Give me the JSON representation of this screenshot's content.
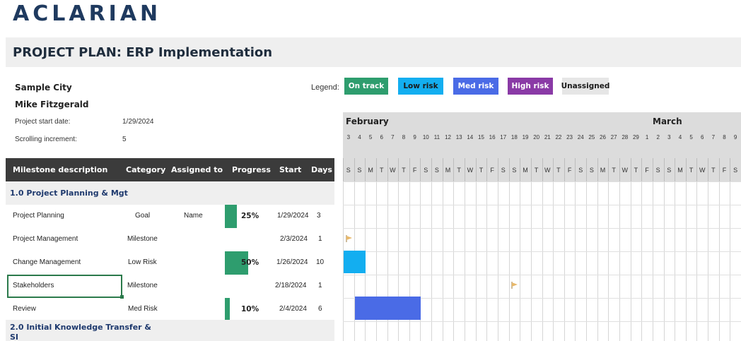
{
  "brand": {
    "logo_text": "ACLARIAN"
  },
  "title": "PROJECT PLAN:  ERP Implementation",
  "info": {
    "company": "Sample City",
    "manager": "Mike Fitzgerald",
    "start_label": "Project start date:",
    "start_value": "1/29/2024",
    "increment_label": "Scrolling increment:",
    "increment_value": "5"
  },
  "legend": {
    "label": "Legend:",
    "items": [
      {
        "label": "On track",
        "bg": "#2e9d6e",
        "fg": "#ffffff"
      },
      {
        "label": "Low risk",
        "bg": "#13aef0",
        "fg": "#1a1a1a"
      },
      {
        "label": "Med risk",
        "bg": "#4a6be6",
        "fg": "#ffffff"
      },
      {
        "label": "High risk",
        "bg": "#8a3aa6",
        "fg": "#ffffff"
      },
      {
        "label": "Unassigned",
        "bg": "#e6e6e6",
        "fg": "#1a1a1a"
      }
    ]
  },
  "table": {
    "headers": {
      "milestone": "Milestone description",
      "category": "Category",
      "assigned": "Assigned to",
      "progress": "Progress",
      "start": "Start",
      "days": "Days"
    },
    "section1": "1.0  Project Planning & Mgt",
    "rows": [
      {
        "milestone": "Project Planning",
        "category": "Goal",
        "assigned": "Name",
        "progress": 25,
        "progress_label": "25%",
        "start": "1/29/2024",
        "days": "3"
      },
      {
        "milestone": "Project Management",
        "category": "Milestone",
        "assigned": "",
        "progress": 0,
        "progress_label": "",
        "start": "2/3/2024",
        "days": "1"
      },
      {
        "milestone": "Change Management",
        "category": "Low Risk",
        "assigned": "",
        "progress": 50,
        "progress_label": "50%",
        "start": "1/26/2024",
        "days": "10"
      },
      {
        "milestone": "Stakeholders",
        "category": "Milestone",
        "assigned": "",
        "progress": 0,
        "progress_label": "",
        "start": "2/18/2024",
        "days": "1"
      },
      {
        "milestone": "Review",
        "category": "Med Risk",
        "assigned": "",
        "progress": 10,
        "progress_label": "10%",
        "start": "2/4/2024",
        "days": "6"
      }
    ],
    "section2_line1": "2.0  Initial Knowledge Transfer &",
    "section2_line2": "SI"
  },
  "gantt": {
    "month1": "February",
    "month2": "March",
    "days": [
      "3",
      "4",
      "5",
      "6",
      "7",
      "8",
      "9",
      "10",
      "11",
      "12",
      "13",
      "14",
      "15",
      "16",
      "17",
      "18",
      "19",
      "20",
      "21",
      "22",
      "23",
      "24",
      "25",
      "26",
      "27",
      "28",
      "29",
      "1",
      "2",
      "3",
      "4",
      "5",
      "6",
      "7",
      "8",
      "9"
    ],
    "weekdays": [
      "S",
      "S",
      "M",
      "T",
      "W",
      "T",
      "F",
      "S",
      "S",
      "M",
      "T",
      "W",
      "T",
      "F",
      "S",
      "S",
      "M",
      "T",
      "W",
      "T",
      "F",
      "S",
      "S",
      "M",
      "T",
      "W",
      "T",
      "F",
      "S",
      "S",
      "M",
      "T",
      "W",
      "T",
      "F",
      "S"
    ],
    "colors": {
      "low_risk": "#13aef0",
      "med_risk": "#4a6be6",
      "flag": "#e8b86a"
    }
  }
}
